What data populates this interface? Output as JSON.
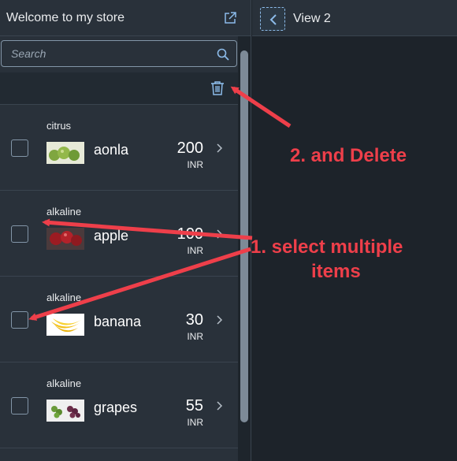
{
  "master": {
    "title": "Welcome to my store",
    "search_placeholder": "Search"
  },
  "detail": {
    "title": "View 2"
  },
  "items": [
    {
      "group": "citrus",
      "name": "aonla",
      "price": "200",
      "currency": "INR"
    },
    {
      "group": "alkaline",
      "name": "apple",
      "price": "100",
      "currency": "INR"
    },
    {
      "group": "alkaline",
      "name": "banana",
      "price": "30",
      "currency": "INR"
    },
    {
      "group": "alkaline",
      "name": "grapes",
      "price": "55",
      "currency": "INR"
    }
  ],
  "annotations": {
    "step2": "2. and Delete",
    "step1_line1": "1. select multiple",
    "step1_line2": "items"
  },
  "colors": {
    "accent": "#8cbbe9",
    "annotation": "#ee3f4a",
    "shell_bg": "#29313a"
  }
}
